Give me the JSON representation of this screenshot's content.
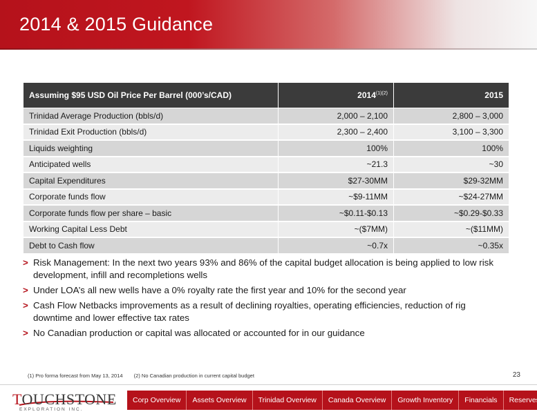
{
  "slide": {
    "title": "2014 & 2015 Guidance",
    "page_number": "23"
  },
  "table": {
    "header": {
      "label": "Assuming $95 USD Oil Price Per Barrel (000’s/CAD)",
      "col_2014": "2014",
      "col_2014_note": "(1)(2)",
      "col_2015": "2015"
    },
    "rows": [
      {
        "label": "Trinidad Average Production (bbls/d)",
        "v2014": "2,000 – 2,100",
        "v2015": "2,800 – 3,000"
      },
      {
        "label": "Trinidad Exit Production (bbls/d)",
        "v2014": "2,300 – 2,400",
        "v2015": "3,100 – 3,300"
      },
      {
        "label": "Liquids weighting",
        "v2014": "100%",
        "v2015": "100%"
      },
      {
        "label": "Anticipated wells",
        "v2014": "~21.3",
        "v2015": "~30"
      },
      {
        "label": "Capital Expenditures",
        "v2014": "$27-30MM",
        "v2015": "$29-32MM"
      },
      {
        "label": "Corporate funds flow",
        "v2014": "~$9-11MM",
        "v2015": "~$24-27MM"
      },
      {
        "label": "Corporate funds flow per share – basic",
        "v2014": "~$0.11-$0.13",
        "v2015": "~$0.29-$0.33"
      },
      {
        "label": "Working Capital Less Debt",
        "v2014": "~($7MM)",
        "v2015": "~($11MM)"
      },
      {
        "label": "Debt to Cash flow",
        "v2014": "~0.7x",
        "v2015": "~0.35x"
      }
    ]
  },
  "bullets": [
    "Risk Management: In the next two years 93% and 86% of the capital budget allocation is being applied to low risk development, infill and recompletions wells",
    "Under LOA’s all new wells have a 0% royalty rate the first year and 10% for the second  year",
    "Cash Flow Netbacks improvements as a result of declining royalties, operating efficiencies, reduction of rig downtime and lower effective tax rates",
    "No Canadian production or capital was allocated or accounted for in our guidance"
  ],
  "bullet_marker": ">",
  "footnotes": {
    "note1": "(1)    Pro forma forecast from May 13, 2014",
    "note2": "(2)    No Canadian production in current capital budget"
  },
  "logo": {
    "word_part1": "T",
    "word_part2": "OUCHSTONE",
    "subtitle": "EXPLORATION INC."
  },
  "nav": [
    "Corp Overview",
    "Assets Overview",
    "Trinidad Overview",
    "Canada Overview",
    "Growth Inventory",
    "Financials",
    "Reserves"
  ],
  "colors": {
    "brand_red": "#b5121b",
    "table_header": "#3b3b3b",
    "row_dark": "#d6d6d6",
    "row_light": "#ececec"
  }
}
